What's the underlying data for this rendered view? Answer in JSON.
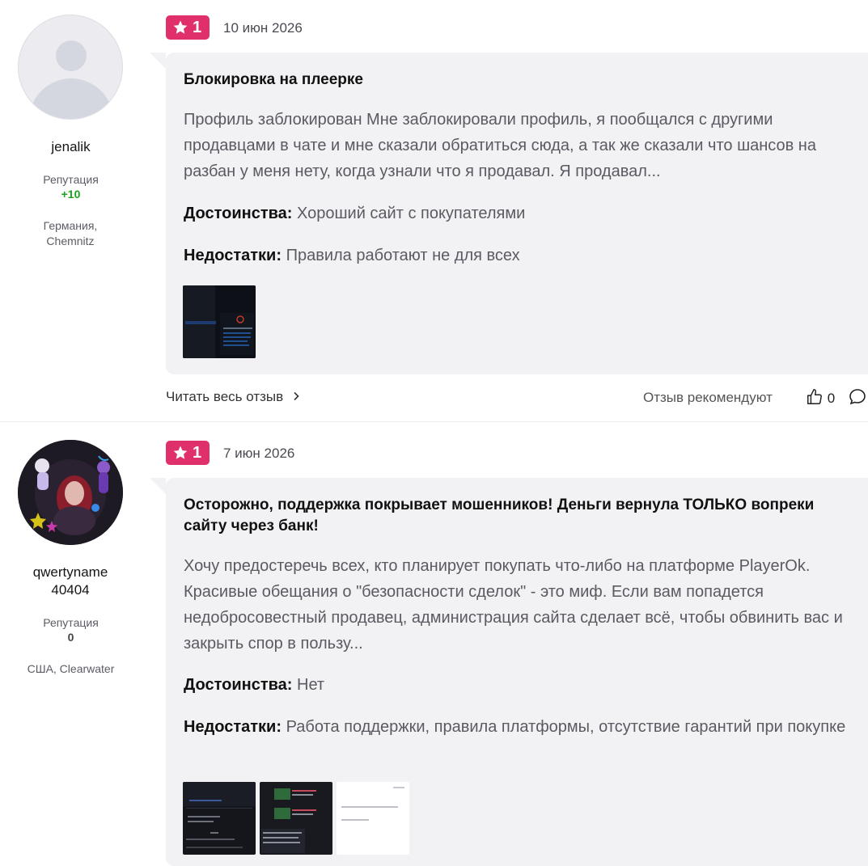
{
  "reviews": [
    {
      "author": {
        "name": "jenalik",
        "reputation_label": "Репутация",
        "reputation": "+10",
        "location": "Германия, Chemnitz",
        "avatar_icon": "default-user-avatar-icon"
      },
      "rating": "1",
      "date": "10 июн 2026",
      "title": "Блокировка на плеерке",
      "text": "Профиль заблокирован Мне заблокировали профиль, я пообщался с другими продавцами в чате и мне сказали обратиться сюда, а так же сказали что шансов на разбан у меня нету, когда узнали что я продавал. Я продавал...",
      "pros_label": "Достоинства:",
      "pros": "Хороший сайт с покупателями",
      "cons_label": "Недостатки:",
      "cons": "Правила работают не для всех",
      "read_more": "Читать весь отзыв",
      "recommend_label": "Отзыв рекомендуют",
      "likes": "0"
    },
    {
      "author": {
        "name": "qwertyname 40404",
        "reputation_label": "Репутация",
        "reputation": "0",
        "location": "США, Clearwater",
        "avatar_icon": "user-photo-avatar"
      },
      "rating": "1",
      "date": "7 июн 2026",
      "title": "Осторожно, поддержка покрывает мошенников! Деньги вернула ТОЛЬКО вопреки сайту через банк!",
      "text": "Хочу предостеречь всех, кто планирует покупать что-либо на платформе PlayerOk. Красивые обещания о \"безопасности сделок\" - это миф. Если вам попадется недобросовестный продавец, администрация сайта сделает всё, чтобы обвинить вас и закрыть спор в пользу...",
      "pros_label": "Достоинства:",
      "pros": "Нет",
      "cons_label": "Недостатки:",
      "cons": "Работа поддержки, правила платформы, отсутствие гарантий при покупке"
    }
  ],
  "colors": {
    "rating_bg": "#e0306c",
    "rep_positive": "#1aa31a",
    "card_bg": "#f2f2f4"
  }
}
